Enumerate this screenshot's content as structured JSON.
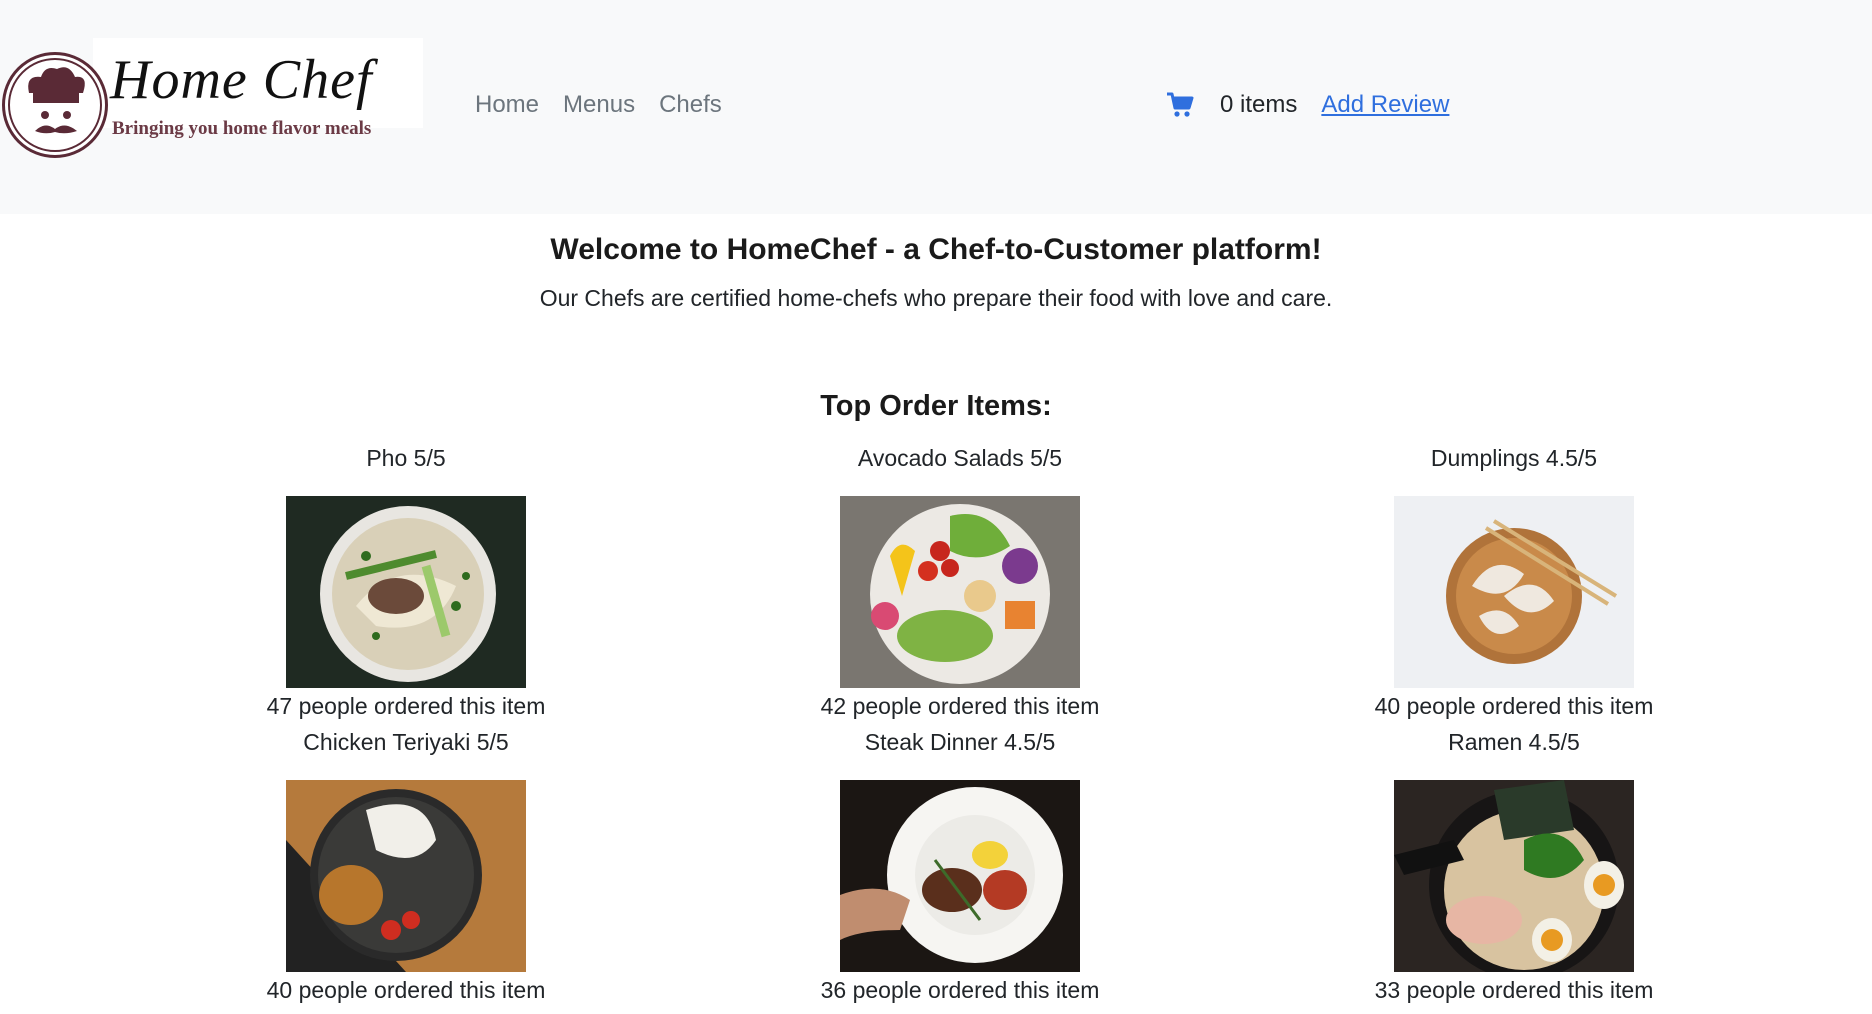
{
  "brand": {
    "name": "Home Chef",
    "tagline": "Bringing you home flavor meals"
  },
  "nav": {
    "links": [
      "Home",
      "Menus",
      "Chefs"
    ]
  },
  "cart": {
    "icon": "shopping-cart-icon",
    "count_label": "0 items",
    "review_link": "Add Review",
    "icon_color": "#2f6fde"
  },
  "intro": {
    "heading": "Welcome to HomeChef - a Chef-to-Customer platform!",
    "text": "Our Chefs are certified home-chefs who prepare their food with love and care."
  },
  "top_items": {
    "heading": "Top Order Items:",
    "items": [
      {
        "title": "Pho 5/5",
        "orders": "47 people ordered this item",
        "image": "pho-bowl"
      },
      {
        "title": "Avocado Salads 5/5",
        "orders": "42 people ordered this item",
        "image": "avocado-salad"
      },
      {
        "title": "Dumplings 4.5/5",
        "orders": "40 people ordered this item",
        "image": "dumplings"
      },
      {
        "title": "Chicken Teriyaki 5/5",
        "orders": "40 people ordered this item",
        "image": "chicken-teriyaki"
      },
      {
        "title": "Steak Dinner 4.5/5",
        "orders": "36 people ordered this item",
        "image": "steak-dinner"
      },
      {
        "title": "Ramen 4.5/5",
        "orders": "33 people ordered this item",
        "image": "ramen"
      }
    ]
  }
}
